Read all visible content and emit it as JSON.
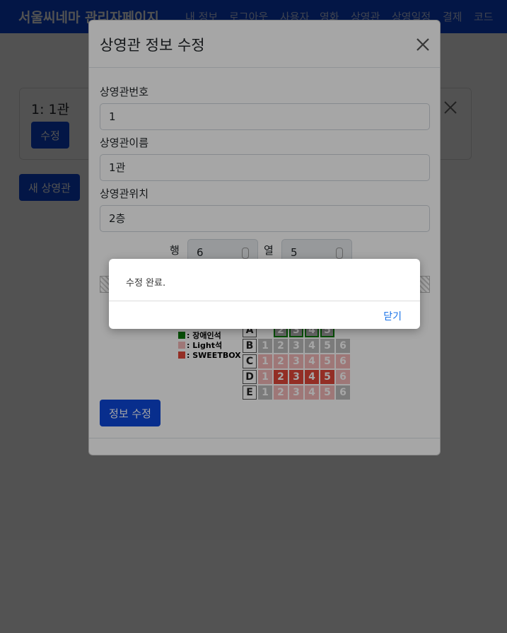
{
  "navbar": {
    "brand": "서울씨네마 관리자페이지",
    "items": [
      "내 정보",
      "로그아웃",
      "사용자",
      "영화",
      "상영관",
      "상영일정",
      "결제",
      "코드"
    ]
  },
  "page": {
    "card_title": "1: 1관",
    "card_edit_label": "수정",
    "new_button_label": "새 상영관"
  },
  "modal": {
    "title": "상영관 정보 수정",
    "fields": [
      {
        "label": "상영관번호",
        "value": "1"
      },
      {
        "label": "상영관이름",
        "value": "1관"
      },
      {
        "label": "상영관위치",
        "value": "2층"
      }
    ],
    "rows_label": "행",
    "rows_value": "6",
    "cols_label": "열",
    "cols_value": "5",
    "legend": [
      {
        "label": ": 장애인석",
        "color": "#0a7a0a"
      },
      {
        "label": ": Light석",
        "color": "#f3b7b7"
      },
      {
        "label": ": SWEETBOX",
        "color": "#e2483a"
      }
    ],
    "seat_rows": [
      "A",
      "B",
      "C",
      "D",
      "E"
    ],
    "seat_cols": [
      "1",
      "2",
      "3",
      "4",
      "5",
      "6"
    ],
    "submit_label": "정보 수정"
  },
  "alert": {
    "message": "수정 완료.",
    "close_label": "닫기"
  },
  "colors": {
    "primary": "#0d47d9",
    "link": "#1a73e8"
  }
}
